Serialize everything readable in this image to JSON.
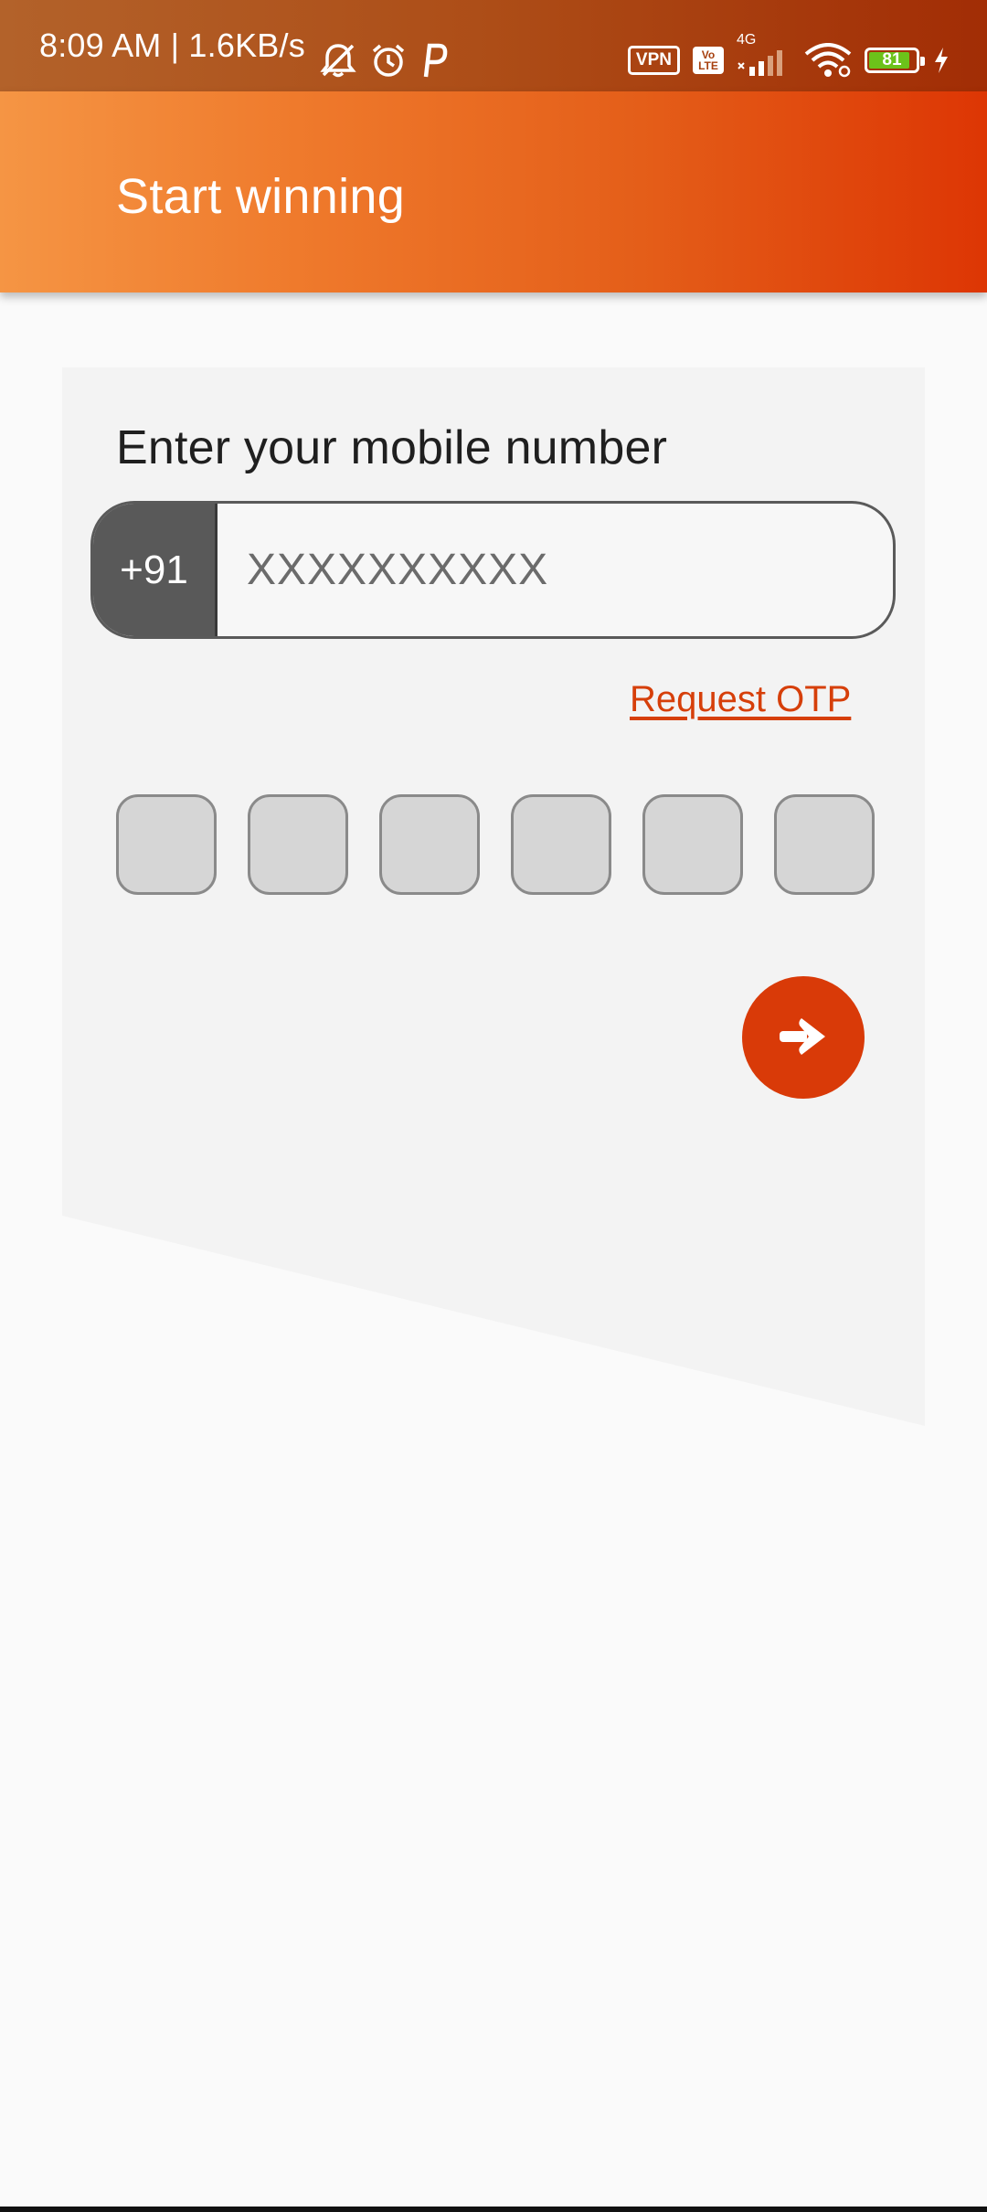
{
  "status_bar": {
    "time": "8:09 AM | 1.6KB/s",
    "vpn": "VPN",
    "volte_top": "Vo",
    "volte_bottom": "LTE",
    "network": "4G",
    "battery": "81"
  },
  "app_bar": {
    "title": "Start winning"
  },
  "form": {
    "heading": "Enter your mobile number",
    "country_code": "+91",
    "phone_placeholder": "XXXXXXXXXX",
    "request_otp": "Request OTP",
    "otp_digits": [
      "",
      "",
      "",
      "",
      "",
      ""
    ]
  },
  "colors": {
    "accent": "#d93a08",
    "link": "#d63f0a",
    "card": "#f3f3f3"
  }
}
